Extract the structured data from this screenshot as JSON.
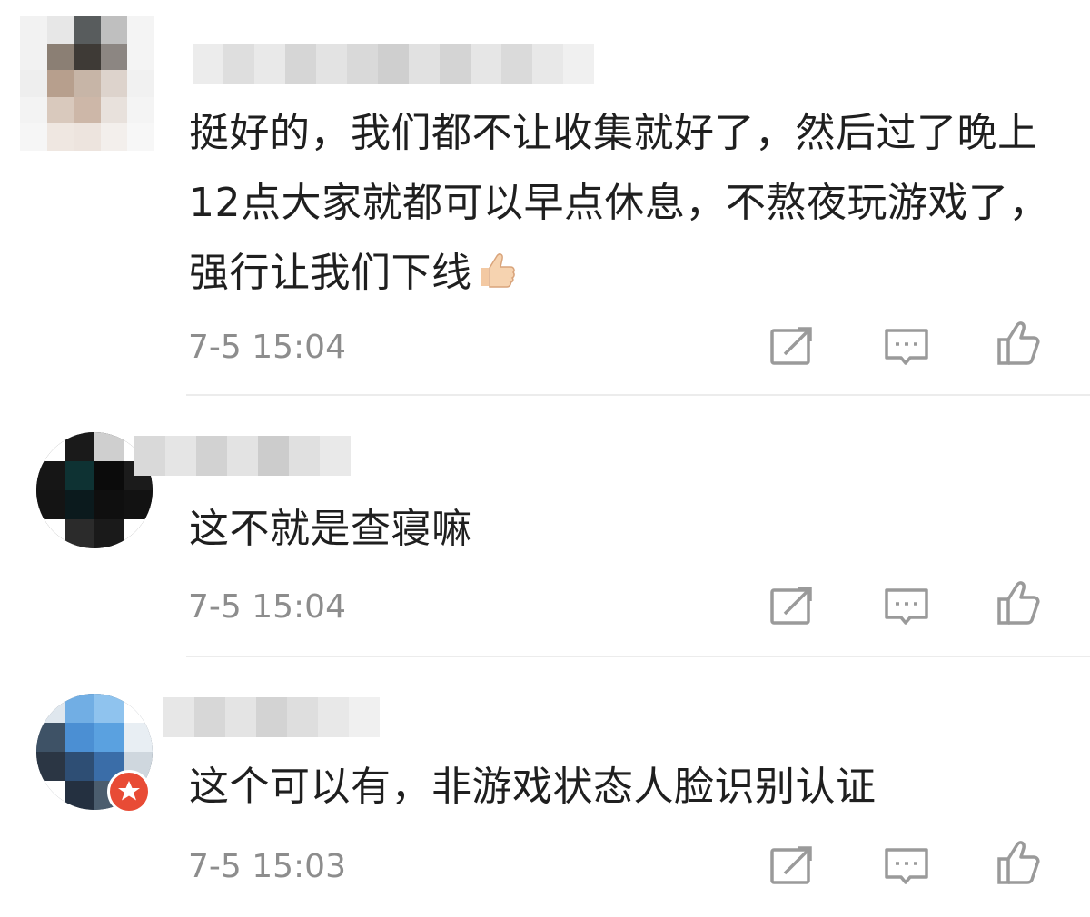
{
  "comments": [
    {
      "text": "挺好的，我们都不让收集就好了，然后过了晚上12点大家就都可以早点休息，不熬夜玩游戏了，强行让我们下线",
      "time": "7-5 15:04",
      "emoji": "thumbs-up-icon"
    },
    {
      "text": "这不就是查寝嘛",
      "time": "7-5 15:04"
    },
    {
      "text": "这个可以有，非游戏状态人脸识别认证",
      "time": "7-5 15:03",
      "badge": "verified-badge-icon"
    }
  ],
  "actions": [
    "share-icon",
    "reply-icon",
    "like-icon"
  ],
  "colors": {
    "text": "#1f1f1f",
    "meta": "#8d8d8d",
    "icon": "#9a9a9a",
    "badge": "#e84b35"
  }
}
